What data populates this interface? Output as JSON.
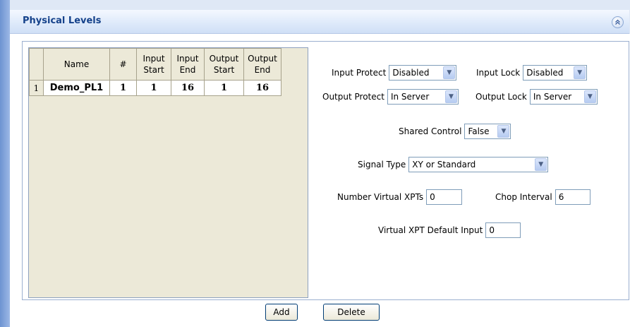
{
  "panel": {
    "title": "Physical Levels",
    "collapse_icon": "double-chevron-up-icon"
  },
  "grid": {
    "columns": [
      "Name",
      "#",
      "Input Start",
      "Input End",
      "Output Start",
      "Output End"
    ],
    "header_lines": [
      [
        "Name"
      ],
      [
        "#"
      ],
      [
        "Input",
        "Start"
      ],
      [
        "Input",
        "End"
      ],
      [
        "Output",
        "Start"
      ],
      [
        "Output",
        "End"
      ]
    ],
    "rows": [
      {
        "index": "1",
        "name": "Demo_PL1",
        "number": "1",
        "input_start": "1",
        "input_end": "16",
        "output_start": "1",
        "output_end": "16"
      }
    ]
  },
  "form": {
    "input_protect": {
      "label": "Input Protect",
      "value": "Disabled"
    },
    "input_lock": {
      "label": "Input Lock",
      "value": "Disabled"
    },
    "output_protect": {
      "label": "Output Protect",
      "value": "In Server"
    },
    "output_lock": {
      "label": "Output Lock",
      "value": "In Server"
    },
    "shared_control": {
      "label": "Shared Control",
      "value": "False"
    },
    "signal_type": {
      "label": "Signal Type",
      "value": "XY or Standard"
    },
    "number_virtual_xpts": {
      "label": "Number Virtual XPTs",
      "value": "0"
    },
    "chop_interval": {
      "label": "Chop Interval",
      "value": "6"
    },
    "virtual_xpt_default_input": {
      "label": "Virtual XPT Default Input",
      "value": "0"
    }
  },
  "buttons": {
    "add": "Add",
    "delete": "Delete"
  },
  "colors": {
    "title_text": "#15428b",
    "panel_header_bg": "#dde9fa",
    "grid_bg": "#ece9d8",
    "border": "#7f9db9"
  }
}
